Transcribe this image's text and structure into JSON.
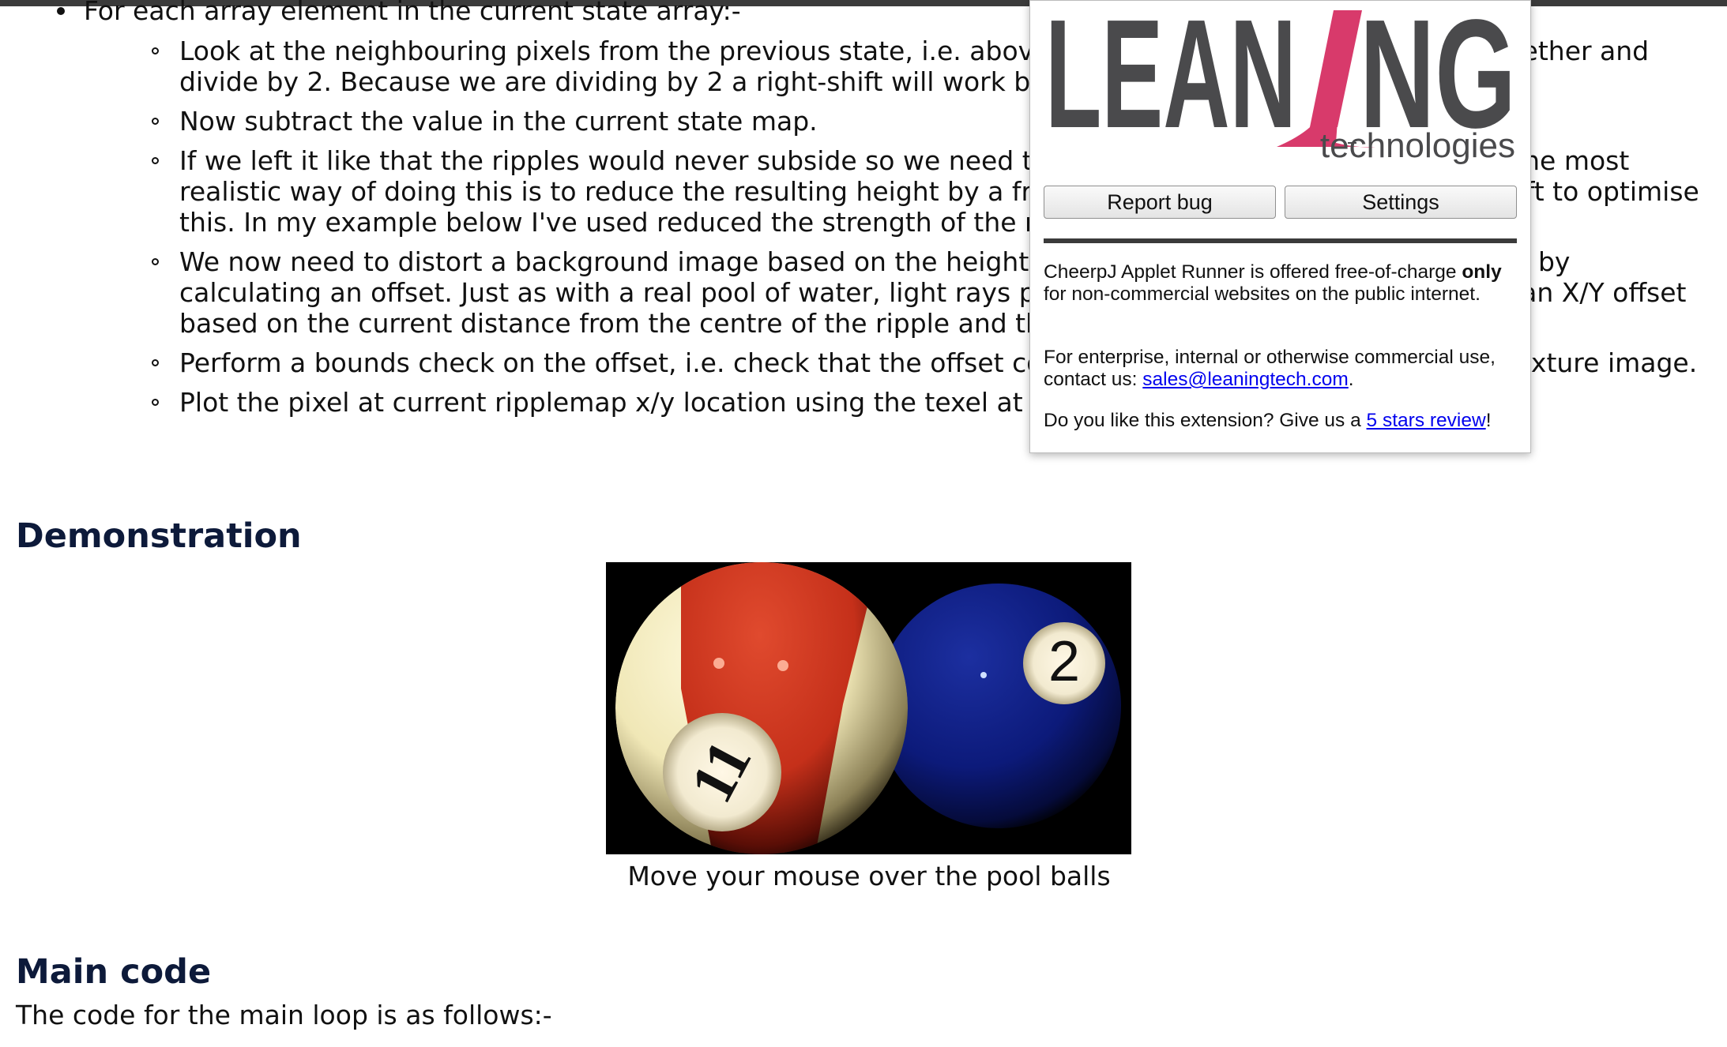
{
  "article": {
    "bullet_intro": "For each array element in the current state array:-",
    "steps": [
      {
        "text": "Look at the neighbouring pixels from the previous state, i.e. above, below, left and right, add them together and divide by 2. Because we are dividing by 2 a right-shift will work beautifully."
      },
      {
        "text": "Now subtract the value in the current state map."
      },
      {
        "text": "If we left it like that the ripples would never subside so we need to dampen the ripples on each pass. The most realistic way of doing this is to reduce the resulting height by a fraction. Again we can use the right-shift to optimise this. In my example below I've used reduced the strength of the ripples each time with a right-shift 5."
      },
      {
        "text": "We now need to distort a background image based on the height of the ripple at each point. We do this by calculating an offset. Just as with a real pool of water, light rays penetrate the surface so we calculate an X/Y offset based on the current distance from the centre of the ripple and the ripple height at this point."
      },
      {
        "text": "Perform a bounds check on the offset, i.e. check that the offset coordinates are within the size of the texture image."
      },
      {
        "text": "Plot the pixel at current ripplemap x/y location using the texel at the calculated offset."
      }
    ],
    "demo_heading": "Demonstration",
    "demo_caption": "Move your mouse over the pool balls",
    "main_code_heading": "Main code",
    "main_code_intro": "The code for the main loop is as follows:-",
    "ball_numbers": {
      "left": "11",
      "right": "2"
    }
  },
  "popup": {
    "logo": {
      "word_left": "LEAN",
      "word_right": "NG",
      "tagline": "technologies",
      "accent_color": "#d83a6b",
      "text_color": "#4a4a4c"
    },
    "report_bug_label": "Report bug",
    "settings_label": "Settings",
    "p1_a": "CheerpJ Applet Runner is offered free-of-charge ",
    "p1_bold": "only",
    "p1_b": " for non-commercial websites on the public internet.",
    "p2_a": "For enterprise, internal or otherwise commercial use, contact us: ",
    "p2_link": "sales@leaningtech.com",
    "p2_b": ".",
    "p3_a": "Do you like this extension? Give us a ",
    "p3_link": "5 stars review",
    "p3_b": "!"
  }
}
